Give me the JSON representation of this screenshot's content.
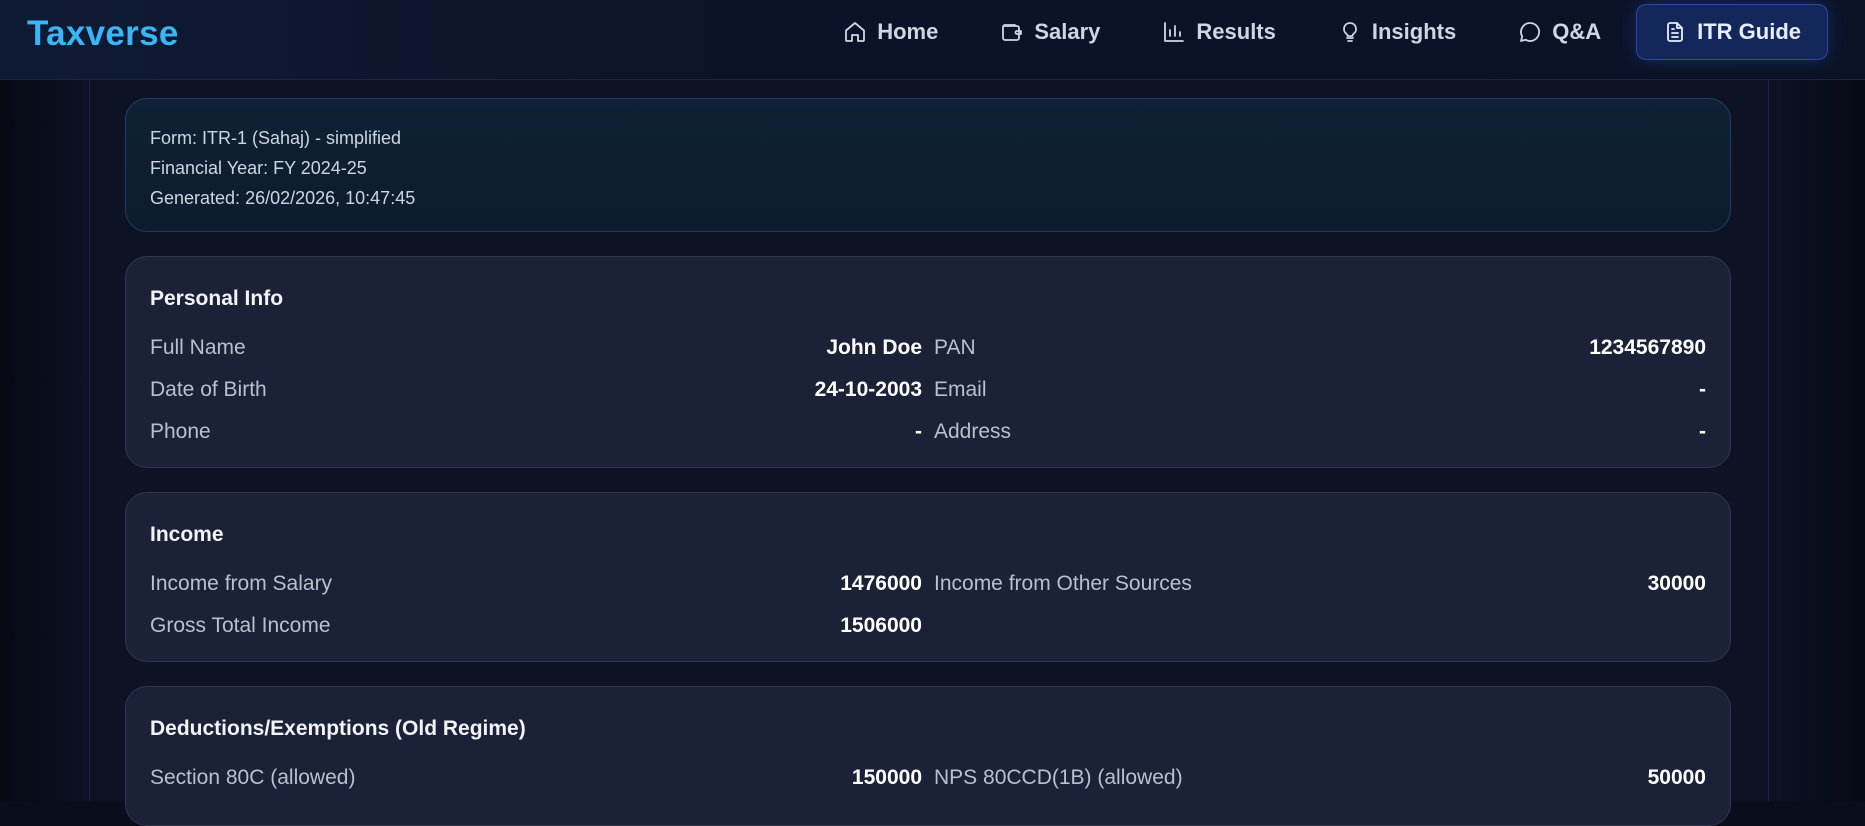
{
  "app": {
    "brand": "Taxverse"
  },
  "nav": [
    {
      "label": "Home",
      "icon": "home-icon"
    },
    {
      "label": "Salary",
      "icon": "wallet-icon"
    },
    {
      "label": "Results",
      "icon": "bar-chart-icon"
    },
    {
      "label": "Insights",
      "icon": "lightbulb-icon"
    },
    {
      "label": "Q&A",
      "icon": "chat-bubble-icon"
    },
    {
      "label": "ITR Guide",
      "icon": "document-icon",
      "active": true
    }
  ],
  "meta": {
    "form": "Form: ITR-1 (Sahaj) - simplified",
    "fy": "Financial Year: FY 2024-25",
    "generated": "Generated: 26/02/2026, 10:47:45"
  },
  "personal": {
    "title": "Personal Info",
    "rows": [
      {
        "label": "Full Name",
        "value": "John Doe"
      },
      {
        "label": "PAN",
        "value": "1234567890"
      },
      {
        "label": "Date of Birth",
        "value": "24-10-2003"
      },
      {
        "label": "Email",
        "value": "-"
      },
      {
        "label": "Phone",
        "value": "-"
      },
      {
        "label": "Address",
        "value": "-"
      }
    ]
  },
  "income": {
    "title": "Income",
    "rows": [
      {
        "label": "Income from Salary",
        "value": "1476000"
      },
      {
        "label": "Income from Other Sources",
        "value": "30000"
      },
      {
        "label": "Gross Total Income",
        "value": "1506000"
      }
    ]
  },
  "deductions": {
    "title": "Deductions/Exemptions (Old Regime)",
    "rows": [
      {
        "label": "Section 80C (allowed)",
        "value": "150000"
      },
      {
        "label": "NPS 80CCD(1B) (allowed)",
        "value": "50000"
      }
    ]
  },
  "colors": {
    "brand": "#38b6f5",
    "active_nav_bg": "#14275a",
    "card_bg": "#1b2136",
    "meta_bg": "#0f2136"
  }
}
